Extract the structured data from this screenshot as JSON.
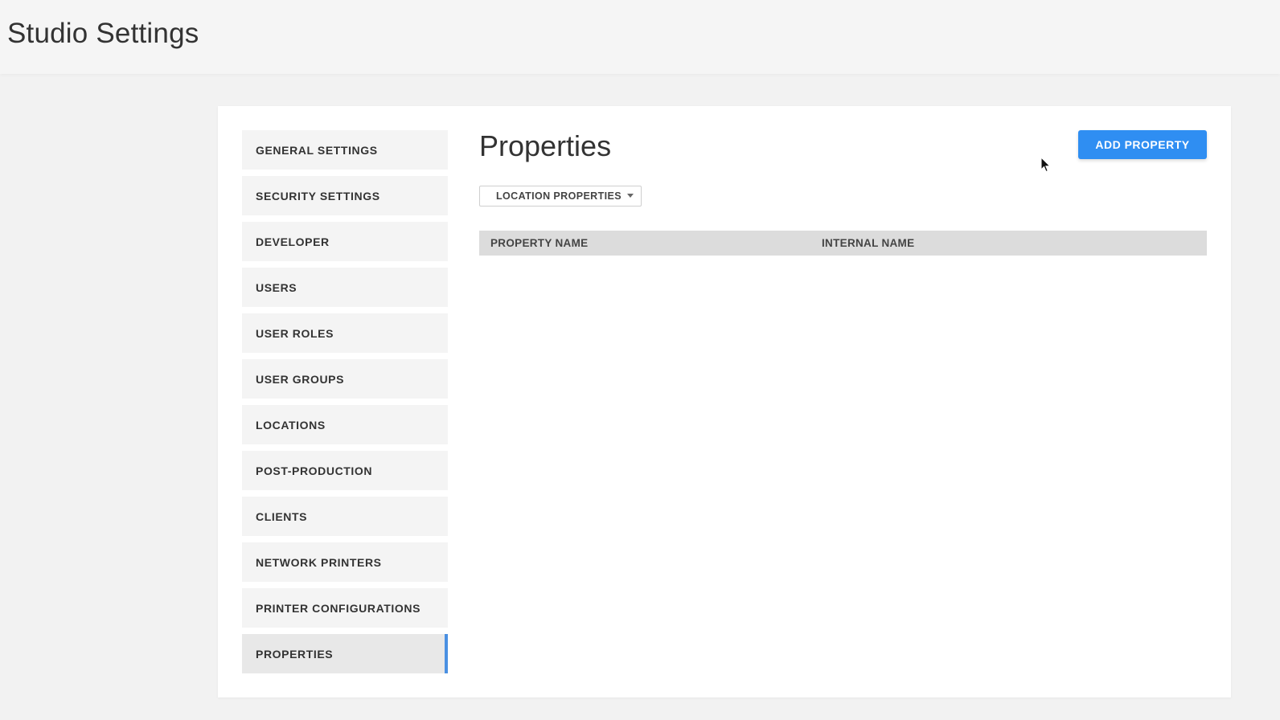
{
  "header": {
    "title": "Studio Settings"
  },
  "sidebar": {
    "items": [
      {
        "label": "GENERAL SETTINGS"
      },
      {
        "label": "SECURITY SETTINGS"
      },
      {
        "label": "DEVELOPER"
      },
      {
        "label": "USERS"
      },
      {
        "label": "USER ROLES"
      },
      {
        "label": "USER GROUPS"
      },
      {
        "label": "LOCATIONS"
      },
      {
        "label": "POST-PRODUCTION"
      },
      {
        "label": "CLIENTS"
      },
      {
        "label": "NETWORK PRINTERS"
      },
      {
        "label": "PRINTER CONFIGURATIONS"
      },
      {
        "label": "PROPERTIES",
        "active": true
      }
    ]
  },
  "main": {
    "title": "Properties",
    "add_button_label": "ADD PROPERTY",
    "filter": {
      "selected": "LOCATION PROPERTIES"
    },
    "table": {
      "columns": [
        "PROPERTY NAME",
        "INTERNAL NAME"
      ],
      "rows": []
    }
  },
  "colors": {
    "accent": "#2f8ef2",
    "active_indicator": "#4a90e2",
    "sidebar_bg": "#f4f4f4",
    "table_header_bg": "#dcdcdc"
  },
  "icons": {
    "dropdown": "chevron-down-icon",
    "cursor": "mouse-pointer-icon"
  }
}
